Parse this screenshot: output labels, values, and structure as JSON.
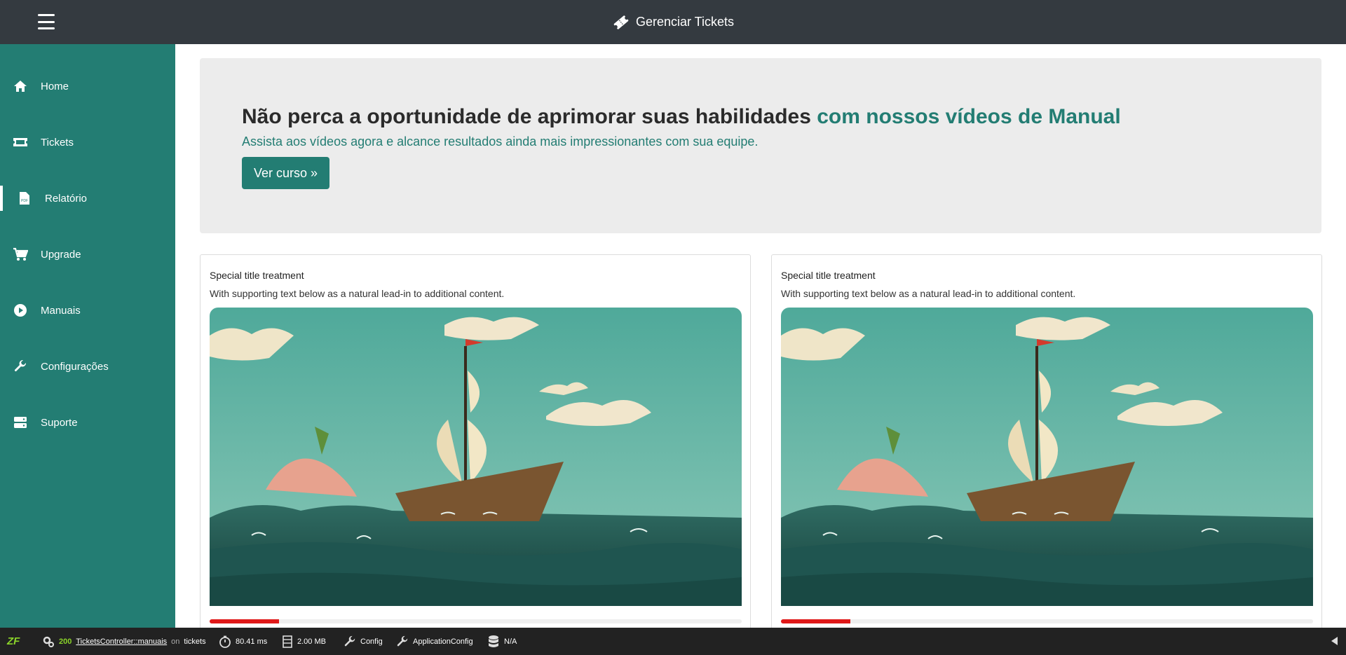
{
  "header": {
    "title": "Gerenciar Tickets"
  },
  "sidebar": {
    "items": [
      {
        "label": "Home",
        "icon": "home-icon"
      },
      {
        "label": "Tickets",
        "icon": "ticket-icon"
      },
      {
        "label": "Relatório",
        "icon": "pdf-file-icon",
        "active": true
      },
      {
        "label": "Upgrade",
        "icon": "cart-icon"
      },
      {
        "label": "Manuais",
        "icon": "play-circle-icon"
      },
      {
        "label": "Configurações",
        "icon": "wrench-icon"
      },
      {
        "label": "Suporte",
        "icon": "server-icon"
      }
    ]
  },
  "jumbotron": {
    "title_main": "Não perca a oportunidade de aprimorar suas habilidades",
    "title_highlight": "com nossos vídeos de Manual",
    "lead": "Assista aos vídeos agora e alcance resultados ainda mais impressionantes com sua equipe.",
    "button": "Ver curso »"
  },
  "cards": [
    {
      "title": "Special title treatment",
      "text": "With supporting text below as a natural lead-in to additional content.",
      "progress": 0.13
    },
    {
      "title": "Special title treatment",
      "text": "With supporting text below as a natural lead-in to additional content.",
      "progress": 0.13
    }
  ],
  "toolbar": {
    "status_code": "200",
    "controller": "TicketsController::manuais",
    "on": "on",
    "route": "tickets",
    "time": "80.41 ms",
    "memory": "2.00 MB",
    "config": "Config",
    "app_config": "ApplicationConfig",
    "db": "N/A"
  },
  "colors": {
    "accent": "#237d73",
    "topbar": "#343a40",
    "toolbar": "#222222",
    "progress": "#e01919"
  }
}
